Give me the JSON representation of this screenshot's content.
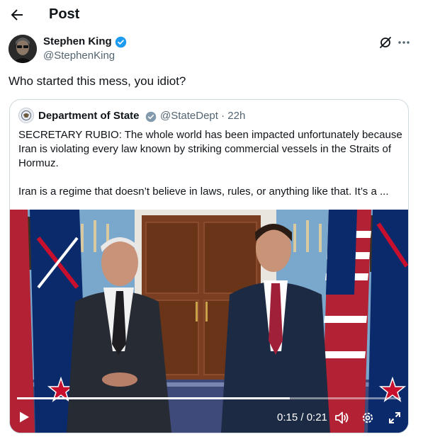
{
  "header": {
    "back_icon": "arrow-left-icon",
    "title": "Post"
  },
  "tweet": {
    "author_name": "Stephen King",
    "author_handle": "@StephenKing",
    "verified_color": "#1d9bf0",
    "text": "Who started this mess, you idiot?"
  },
  "quote": {
    "author_name": "Department of State",
    "handle_time": "@StateDept · 22h",
    "paragraphs": [
      "SECRETARY RUBIO: The whole world has been impacted unfortunately because Iran is violating every law known by striking commercial vessels in the Straits of Hormuz.",
      "Iran is a regime that doesn’t believe in laws, rules, or anything like that. It’s a ..."
    ],
    "verified_color": "#829aab"
  },
  "video": {
    "current_time": "0:15",
    "duration": "0:21",
    "time_display": "0:15 / 0:21",
    "progress": 0.71
  }
}
